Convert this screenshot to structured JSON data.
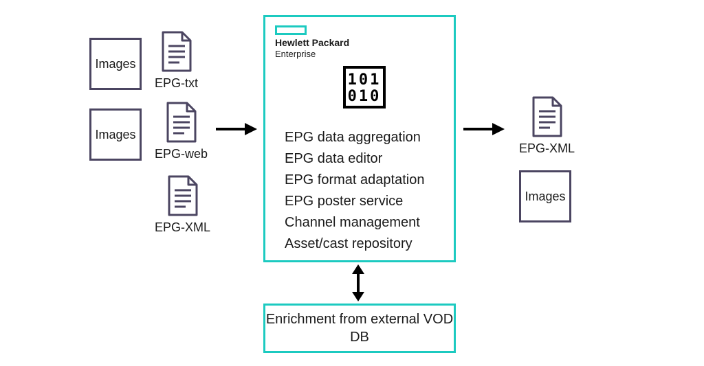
{
  "inputs": {
    "image1": "Images",
    "image2": "Images",
    "doc1": "EPG-txt",
    "doc2": "EPG-web",
    "doc3": "EPG-XML"
  },
  "main": {
    "brand_line1": "Hewlett Packard",
    "brand_line2": "Enterprise",
    "features": {
      "f1": "EPG data aggregation",
      "f2": "EPG data editor",
      "f3": "EPG format adaptation",
      "f4": "EPG poster service",
      "f5": "Channel management",
      "f6": "Asset/cast repository"
    }
  },
  "outputs": {
    "doc": "EPG-XML",
    "image": "Images"
  },
  "enrichment": "Enrichment from external VOD DB",
  "colors": {
    "accent": "#1ccac0",
    "outline": "#4b4561"
  }
}
